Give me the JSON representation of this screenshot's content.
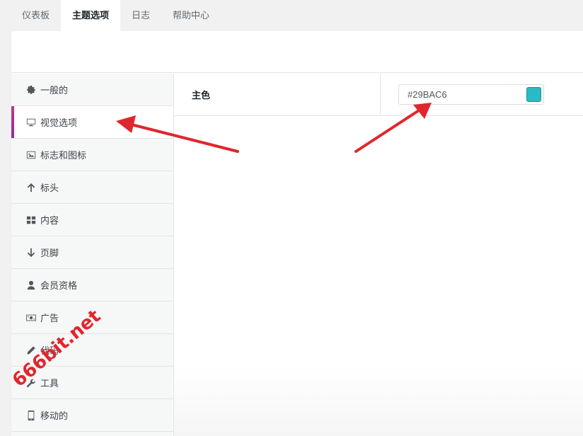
{
  "tabs": [
    {
      "label": "仪表板"
    },
    {
      "label": "主题选项"
    },
    {
      "label": "日志"
    },
    {
      "label": "帮助中心"
    }
  ],
  "sidebar": {
    "items": [
      {
        "label": "一般的",
        "icon": "gear-icon"
      },
      {
        "label": "视觉选项",
        "icon": "monitor-icon"
      },
      {
        "label": "标志和图标",
        "icon": "image-icon"
      },
      {
        "label": "标头",
        "icon": "arrow-up-icon"
      },
      {
        "label": "内容",
        "icon": "grid-icon"
      },
      {
        "label": "页脚",
        "icon": "arrow-down-icon"
      },
      {
        "label": "会员资格",
        "icon": "user-icon"
      },
      {
        "label": "广告",
        "icon": "money-icon"
      },
      {
        "label": "代码",
        "icon": "pencil-icon"
      },
      {
        "label": "工具",
        "icon": "wrench-icon"
      },
      {
        "label": "移动的",
        "icon": "mobile-icon"
      }
    ]
  },
  "main": {
    "primary_color_label": "主色",
    "primary_color_value": "#29BAC6"
  },
  "watermark": "666bit.net",
  "colors": {
    "accent": "#c2387e",
    "swatch": "#29BAC6",
    "arrow": "#e0262d"
  }
}
